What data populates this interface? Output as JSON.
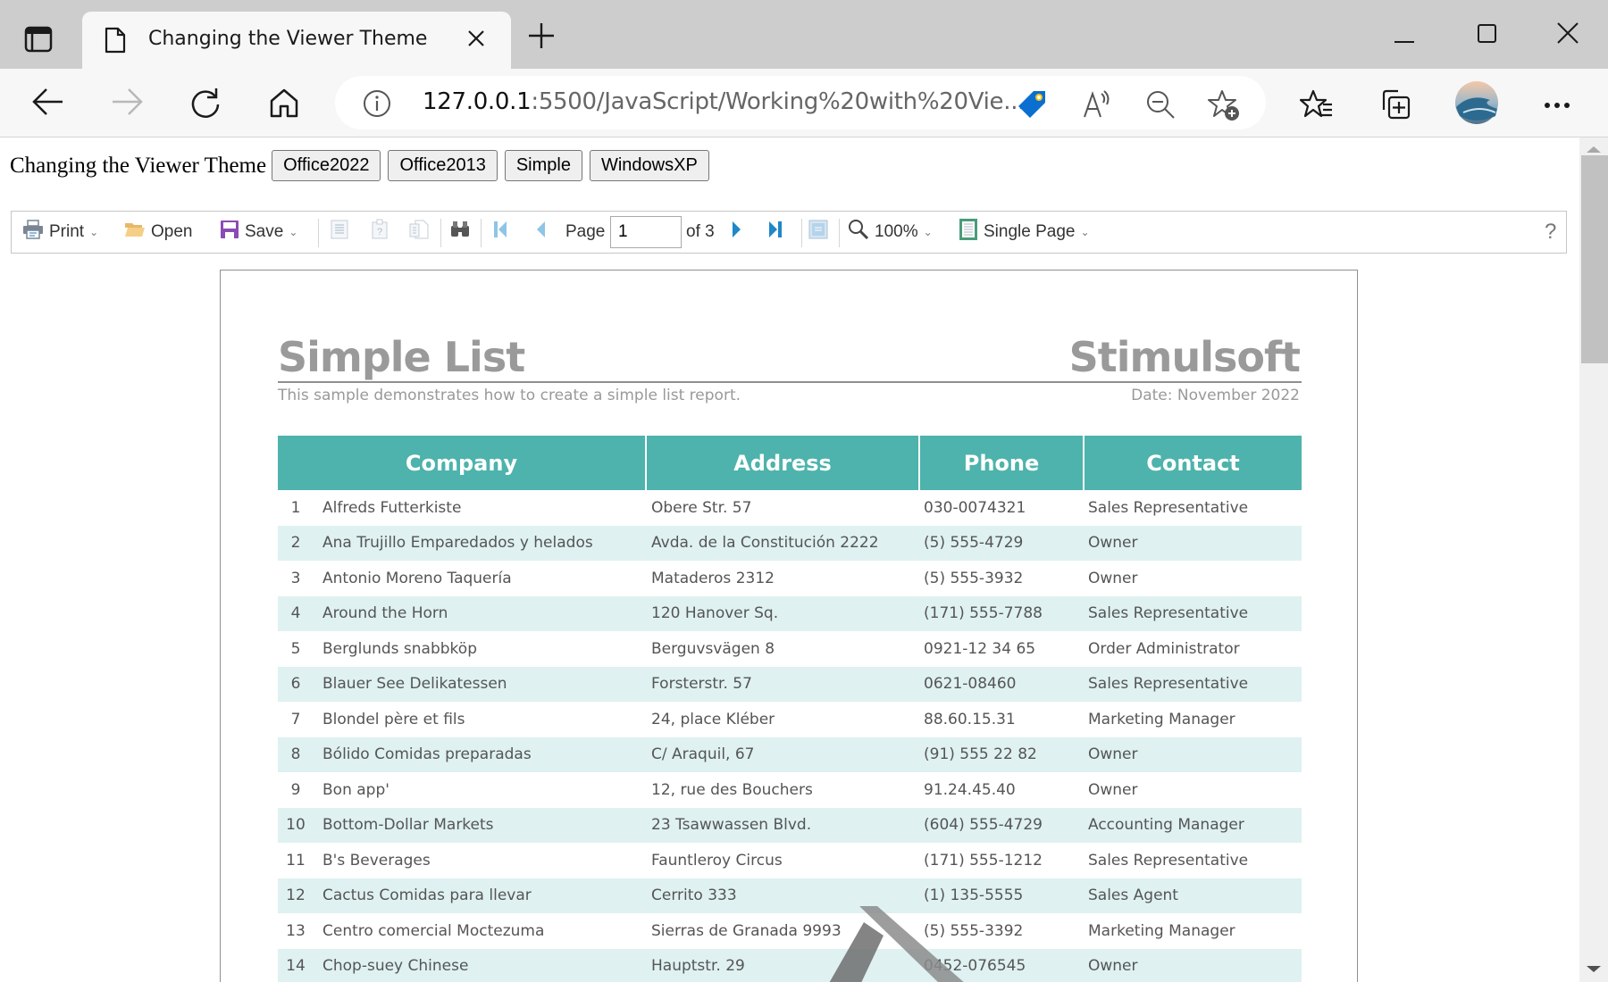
{
  "browser": {
    "tab_title": "Changing the Viewer Theme",
    "url_host": "127.0.0.1",
    "url_rest": ":5500/JavaScript/Working%20with%20Vie...",
    "icons": [
      "tab-actions-icon",
      "page-icon",
      "close-icon",
      "new-tab-icon",
      "minimize-icon",
      "maximize-icon",
      "window-close-icon",
      "back-icon",
      "forward-icon",
      "refresh-icon",
      "home-icon",
      "info-icon",
      "coupon-tag-icon",
      "read-aloud-icon",
      "zoom-out-icon",
      "add-favorite-icon",
      "favorites-icon",
      "collections-icon",
      "profile-avatar",
      "more-icon"
    ]
  },
  "theme_row": {
    "label": "Changing the Viewer Theme",
    "buttons": [
      "Office2022",
      "Office2013",
      "Simple",
      "WindowsXP"
    ]
  },
  "toolbar": {
    "print": "Print",
    "open": "Open",
    "save": "Save",
    "page_label": "Page",
    "page_value": "1",
    "page_of": "of 3",
    "zoom": "100%",
    "view_mode": "Single Page",
    "help": "?",
    "colors": {
      "nav_arrow": "#1e88c8",
      "save_icon": "#8b4bb5",
      "folder_icon": "#f0c070"
    }
  },
  "report": {
    "title": "Simple List",
    "brand": "Stimulsoft",
    "subtitle": "This sample demonstrates how to create a simple list report.",
    "date": "Date: November 2022",
    "header_color": "#4db3ac",
    "alt_row_color": "#dff1f1",
    "columns": [
      "Company",
      "Address",
      "Phone",
      "Contact"
    ],
    "rows": [
      {
        "n": "1",
        "company": "Alfreds Futterkiste",
        "address": "Obere Str. 57",
        "phone": "030-0074321",
        "contact": "Sales Representative"
      },
      {
        "n": "2",
        "company": "Ana Trujillo Emparedados y helados",
        "address": "Avda. de la Constitución 2222",
        "phone": "(5) 555-4729",
        "contact": "Owner"
      },
      {
        "n": "3",
        "company": "Antonio Moreno Taquería",
        "address": "Mataderos 2312",
        "phone": "(5) 555-3932",
        "contact": "Owner"
      },
      {
        "n": "4",
        "company": "Around the Horn",
        "address": "120 Hanover Sq.",
        "phone": "(171) 555-7788",
        "contact": "Sales Representative"
      },
      {
        "n": "5",
        "company": "Berglunds snabbköp",
        "address": "Berguvsvägen 8",
        "phone": "0921-12 34 65",
        "contact": "Order Administrator"
      },
      {
        "n": "6",
        "company": "Blauer See Delikatessen",
        "address": "Forsterstr. 57",
        "phone": "0621-08460",
        "contact": "Sales Representative"
      },
      {
        "n": "7",
        "company": "Blondel père et fils",
        "address": "24, place Kléber",
        "phone": "88.60.15.31",
        "contact": "Marketing Manager"
      },
      {
        "n": "8",
        "company": "Bólido Comidas preparadas",
        "address": "C/ Araquil, 67",
        "phone": "(91) 555 22 82",
        "contact": "Owner"
      },
      {
        "n": "9",
        "company": "Bon app'",
        "address": "12, rue des Bouchers",
        "phone": "91.24.45.40",
        "contact": "Owner"
      },
      {
        "n": "10",
        "company": "Bottom-Dollar Markets",
        "address": "23 Tsawwassen Blvd.",
        "phone": "(604) 555-4729",
        "contact": "Accounting Manager"
      },
      {
        "n": "11",
        "company": "B's Beverages",
        "address": "Fauntleroy Circus",
        "phone": "(171) 555-1212",
        "contact": "Sales Representative"
      },
      {
        "n": "12",
        "company": "Cactus Comidas para llevar",
        "address": "Cerrito 333",
        "phone": "(1) 135-5555",
        "contact": "Sales Agent"
      },
      {
        "n": "13",
        "company": "Centro comercial Moctezuma",
        "address": "Sierras de Granada 9993",
        "phone": "(5) 555-3392",
        "contact": "Marketing Manager"
      },
      {
        "n": "14",
        "company": "Chop-suey Chinese",
        "address": "Hauptstr. 29",
        "phone": "0452-076545",
        "contact": "Owner"
      }
    ]
  }
}
